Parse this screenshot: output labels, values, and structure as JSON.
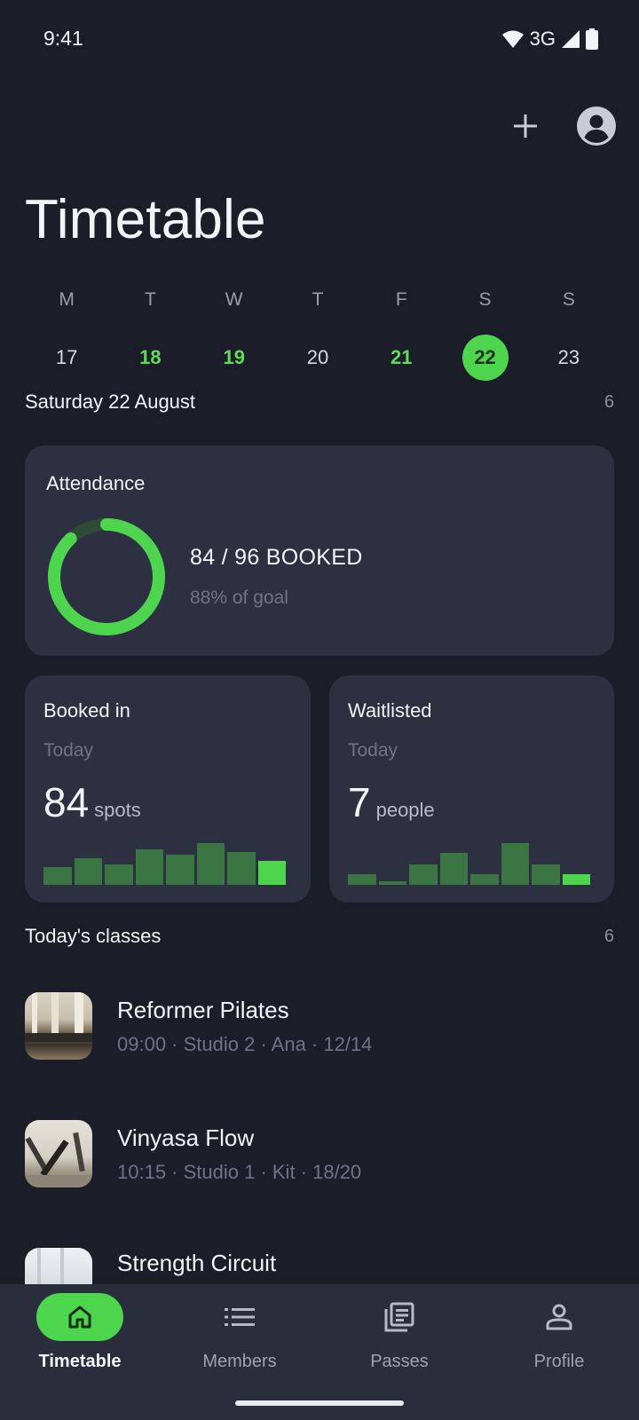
{
  "status_bar": {
    "time": "9:41",
    "network": "3G",
    "icons": [
      "wifi-icon",
      "signal-icon",
      "battery-icon"
    ]
  },
  "header": {
    "title": "Timetable",
    "actions": [
      "add-icon",
      "account-icon"
    ]
  },
  "week": {
    "days": [
      {
        "letter": "M",
        "num": "17",
        "has_classes": false,
        "selected": false
      },
      {
        "letter": "T",
        "num": "18",
        "has_classes": true,
        "selected": false
      },
      {
        "letter": "W",
        "num": "19",
        "has_classes": true,
        "selected": false
      },
      {
        "letter": "T",
        "num": "20",
        "has_classes": false,
        "selected": false
      },
      {
        "letter": "F",
        "num": "21",
        "has_classes": true,
        "selected": false
      },
      {
        "letter": "S",
        "num": "22",
        "has_classes": true,
        "selected": true
      },
      {
        "letter": "S",
        "num": "23",
        "has_classes": false,
        "selected": false
      }
    ]
  },
  "selected_day": {
    "label": "Saturday 22 August",
    "count": "6"
  },
  "attendance": {
    "title": "Attendance",
    "booked": "84 / 96 BOOKED",
    "goal": "88% of goal",
    "progress": 0.88
  },
  "booked_in": {
    "title": "Booked in",
    "period": "Today",
    "value": "84",
    "unit": "spots",
    "bars": [
      0.33,
      0.5,
      0.38,
      0.67,
      0.57,
      0.78,
      0.62,
      0.45
    ]
  },
  "waitlisted": {
    "title": "Waitlisted",
    "period": "Today",
    "value": "7",
    "unit": "people",
    "bars": [
      0.2,
      0.06,
      0.38,
      0.6,
      0.2,
      0.78,
      0.38,
      0.2
    ]
  },
  "classes": {
    "title": "Today's classes",
    "count": "6",
    "items": [
      {
        "name": "Reformer Pilates",
        "meta": "09:00 · Studio 2 · Ana · 12/14"
      },
      {
        "name": "Vinyasa Flow",
        "meta": "10:15 · Studio 1 · Kit · 18/20"
      },
      {
        "name": "Strength Circuit",
        "meta": ""
      }
    ]
  },
  "nav": {
    "items": [
      {
        "label": "Timetable",
        "icon": "home-icon",
        "active": true
      },
      {
        "label": "Members",
        "icon": "list-icon",
        "active": false
      },
      {
        "label": "Passes",
        "icon": "passes-icon",
        "active": false
      },
      {
        "label": "Profile",
        "icon": "person-icon",
        "active": false
      }
    ]
  },
  "colors": {
    "accent": "#4cd54d",
    "background": "#1b1d28",
    "card": "#2c3040",
    "nav": "#2a2e3c"
  }
}
